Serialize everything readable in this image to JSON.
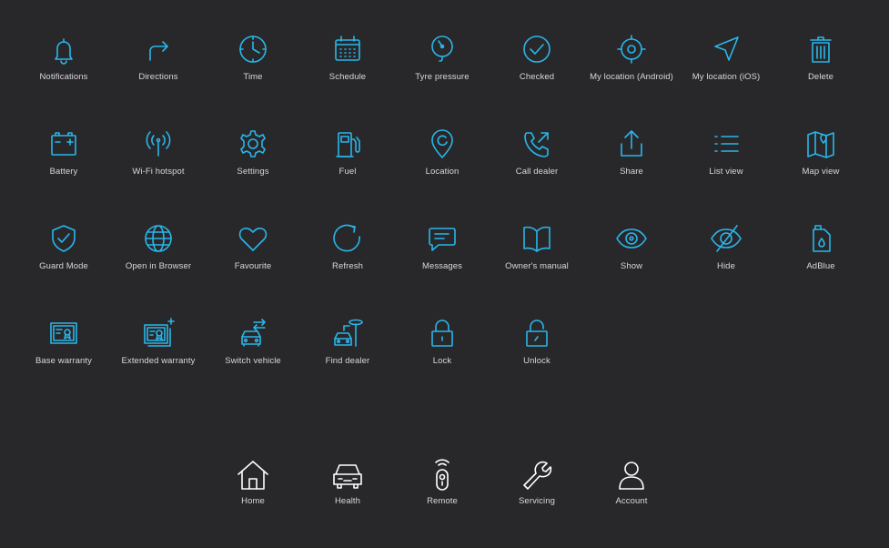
{
  "colors": {
    "background": "#28282b",
    "icon_accent": "#29b6ea",
    "icon_nav": "#ffffff",
    "label": "#d8d8dc"
  },
  "icon_set": [
    {
      "name": "Notifications",
      "icon": "bell-icon"
    },
    {
      "name": "Directions",
      "icon": "directions-icon"
    },
    {
      "name": "Time",
      "icon": "clock-icon"
    },
    {
      "name": "Schedule",
      "icon": "calendar-icon"
    },
    {
      "name": "Tyre pressure",
      "icon": "tyre-pressure-icon"
    },
    {
      "name": "Checked",
      "icon": "check-circle-icon"
    },
    {
      "name": "My location (Android)",
      "icon": "crosshair-icon"
    },
    {
      "name": "My location (iOS)",
      "icon": "location-arrow-icon"
    },
    {
      "name": "Delete",
      "icon": "trash-icon"
    },
    {
      "name": "Battery",
      "icon": "battery-icon"
    },
    {
      "name": "Wi-Fi hotspot",
      "icon": "wifi-hotspot-icon"
    },
    {
      "name": "Settings",
      "icon": "gear-icon"
    },
    {
      "name": "Fuel",
      "icon": "fuel-pump-icon"
    },
    {
      "name": "Location",
      "icon": "map-pin-icon"
    },
    {
      "name": "Call dealer",
      "icon": "phone-outgoing-icon"
    },
    {
      "name": "Share",
      "icon": "share-icon"
    },
    {
      "name": "List view",
      "icon": "list-icon"
    },
    {
      "name": "Map view",
      "icon": "map-icon"
    },
    {
      "name": "Guard Mode",
      "icon": "shield-check-icon"
    },
    {
      "name": "Open in Browser",
      "icon": "globe-icon"
    },
    {
      "name": "Favourite",
      "icon": "heart-icon"
    },
    {
      "name": "Refresh",
      "icon": "refresh-icon"
    },
    {
      "name": "Messages",
      "icon": "message-icon"
    },
    {
      "name": "Owner's manual",
      "icon": "book-icon"
    },
    {
      "name": "Show",
      "icon": "eye-icon"
    },
    {
      "name": "Hide",
      "icon": "eye-off-icon"
    },
    {
      "name": "AdBlue",
      "icon": "adblue-can-icon"
    },
    {
      "name": "Base warranty",
      "icon": "certificate-icon"
    },
    {
      "name": "Extended warranty",
      "icon": "certificate-plus-icon"
    },
    {
      "name": "Switch vehicle",
      "icon": "switch-vehicle-icon"
    },
    {
      "name": "Find dealer",
      "icon": "find-dealer-icon"
    },
    {
      "name": "Lock",
      "icon": "lock-icon"
    },
    {
      "name": "Unlock",
      "icon": "unlock-icon"
    }
  ],
  "bottom_nav": [
    {
      "name": "Home",
      "icon": "home-icon"
    },
    {
      "name": "Health",
      "icon": "car-front-icon"
    },
    {
      "name": "Remote",
      "icon": "key-fob-icon"
    },
    {
      "name": "Servicing",
      "icon": "wrench-icon"
    },
    {
      "name": "Account",
      "icon": "person-icon"
    }
  ]
}
